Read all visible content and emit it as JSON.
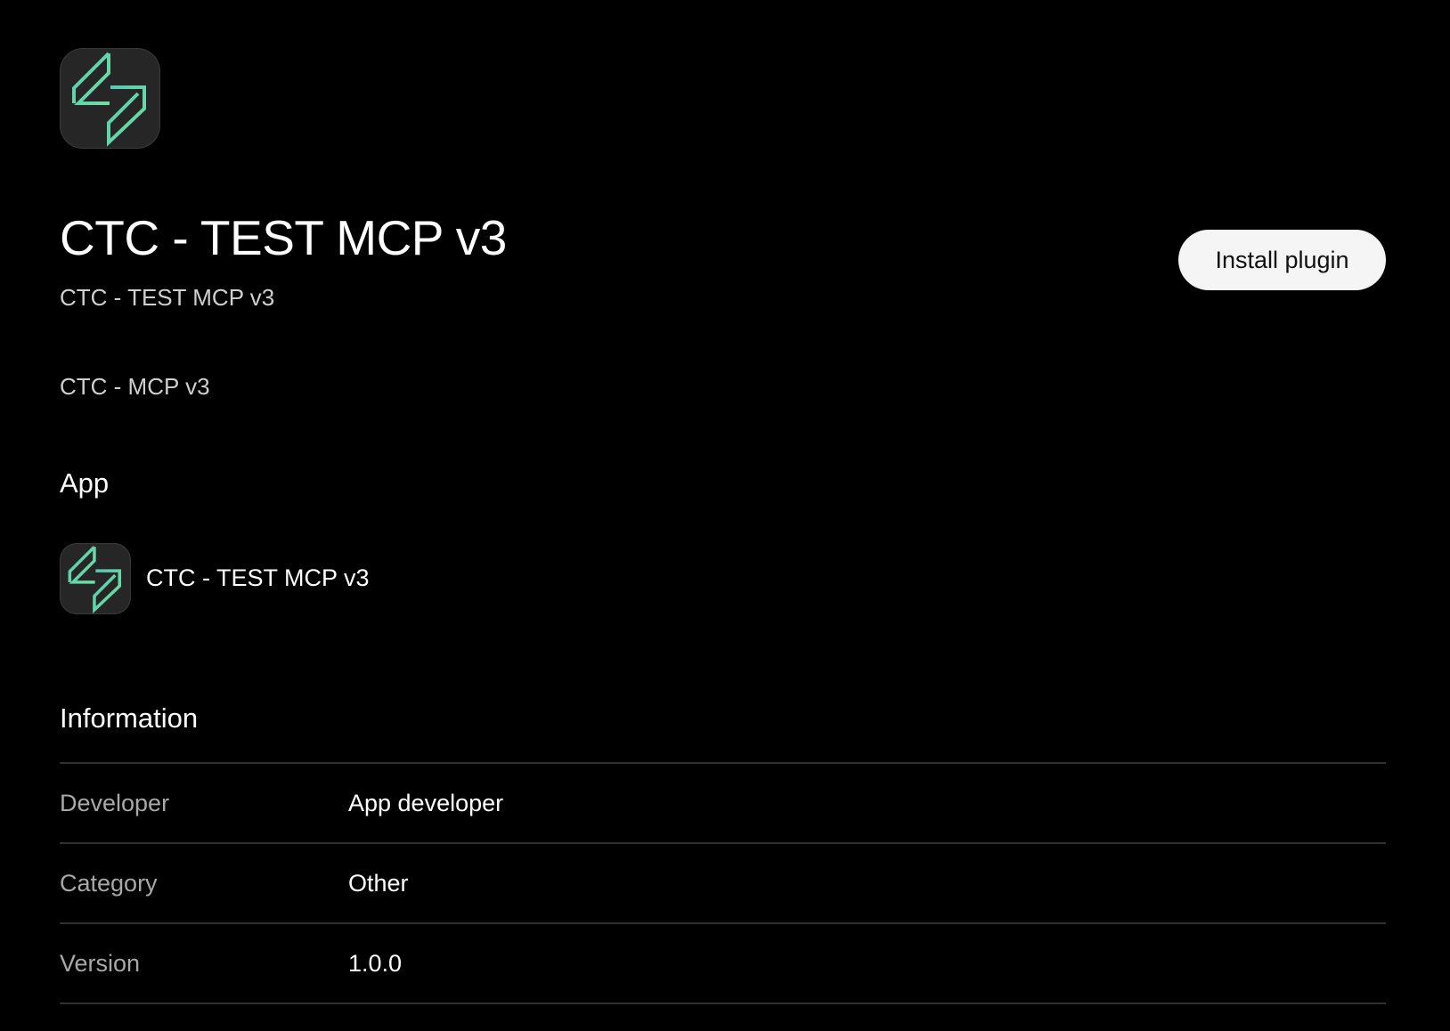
{
  "plugin": {
    "title": "CTC - TEST MCP v3",
    "subtitle": "CTC - TEST MCP v3",
    "description": "CTC - MCP v3",
    "install_label": "Install plugin",
    "icon": "mcp-logo-icon",
    "accent_color": "#5fd6a8"
  },
  "app_section": {
    "heading": "App",
    "app_name": "CTC - TEST MCP v3",
    "icon": "mcp-logo-icon"
  },
  "information": {
    "heading": "Information",
    "rows": [
      {
        "label": "Developer",
        "value": "App developer"
      },
      {
        "label": "Category",
        "value": "Other"
      },
      {
        "label": "Version",
        "value": "1.0.0"
      }
    ]
  }
}
